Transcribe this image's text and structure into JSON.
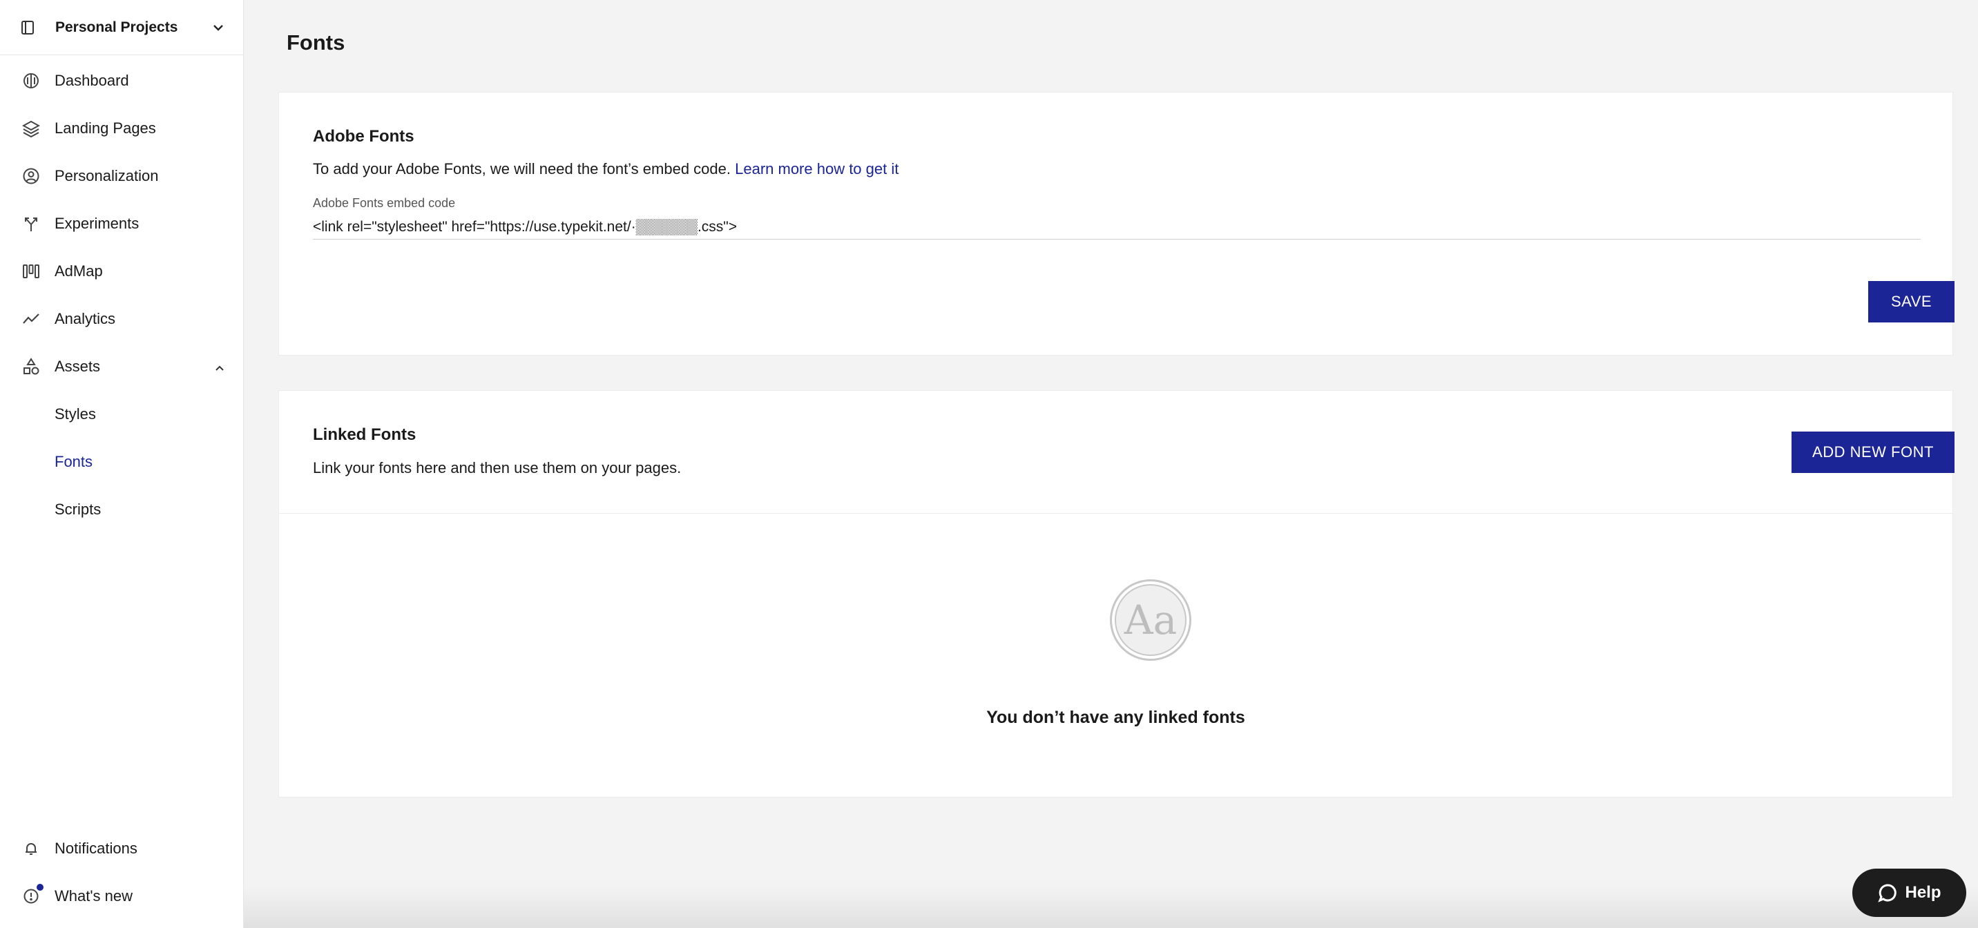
{
  "workspace": {
    "name": "Personal Projects"
  },
  "sidebar": {
    "items": [
      {
        "label": "Dashboard"
      },
      {
        "label": "Landing Pages"
      },
      {
        "label": "Personalization"
      },
      {
        "label": "Experiments"
      },
      {
        "label": "AdMap"
      },
      {
        "label": "Analytics"
      },
      {
        "label": "Assets"
      }
    ],
    "sub_items": [
      {
        "label": "Styles"
      },
      {
        "label": "Fonts",
        "active": true
      },
      {
        "label": "Scripts"
      }
    ],
    "bottom": [
      {
        "label": "Notifications"
      },
      {
        "label": "What's new"
      }
    ]
  },
  "page": {
    "title": "Fonts"
  },
  "adobe": {
    "title": "Adobe Fonts",
    "description": "To add your Adobe Fonts, we will need the font’s embed code.",
    "link": "Learn more how to get it",
    "field_label": "Adobe Fonts embed code",
    "field_value": "<link rel=\"stylesheet\" href=\"https://use.typekit.net/·▒▒▒▒▒▒.css\">",
    "save_label": "SAVE"
  },
  "linked": {
    "title": "Linked Fonts",
    "description": "Link your fonts here and then use them on your pages.",
    "add_label": "ADD NEW FONT",
    "empty_icon_text": "Aa",
    "empty_text": "You don’t have any linked fonts"
  },
  "help": {
    "label": "Help"
  },
  "colors": {
    "accent": "#1b2596",
    "background": "#f3f3f3"
  }
}
